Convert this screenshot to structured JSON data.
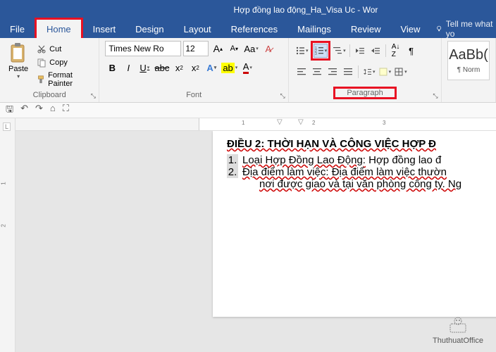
{
  "title": "Hợp đồng lao động_Ha_Visa Uc - Wor",
  "menu": {
    "file": "File",
    "home": "Home",
    "insert": "Insert",
    "design": "Design",
    "layout": "Layout",
    "references": "References",
    "mailings": "Mailings",
    "review": "Review",
    "view": "View",
    "tell": "Tell me what yo"
  },
  "clipboard": {
    "paste": "Paste",
    "cut": "Cut",
    "copy": "Copy",
    "painter": "Format Painter",
    "label": "Clipboard"
  },
  "font": {
    "name": "Times New Ro",
    "size": "12",
    "label": "Font"
  },
  "paragraph": {
    "label": "Paragraph"
  },
  "styles": {
    "preview": "AaBb(",
    "name": "¶ Norm"
  },
  "doc": {
    "heading": "ĐIỀU 2: THỜI HẠN VÀ CÔNG VIỆC HỢP Đ",
    "item1_label": "Loại Hợp Đồng Lao Động:",
    "item1_text": " Hợp đồng lao đ",
    "item2_label": "Địa điểm làm việc:",
    "item2_text": " Địa điểm làm việc thườn",
    "item2_line2": "nơi được giao và tại văn phòng công ty. Ng"
  },
  "ruler_h_nums": [
    "1",
    "2",
    "3"
  ],
  "ruler_v_nums": [
    "1",
    "2"
  ],
  "watermark": "ThuthuatOffice"
}
